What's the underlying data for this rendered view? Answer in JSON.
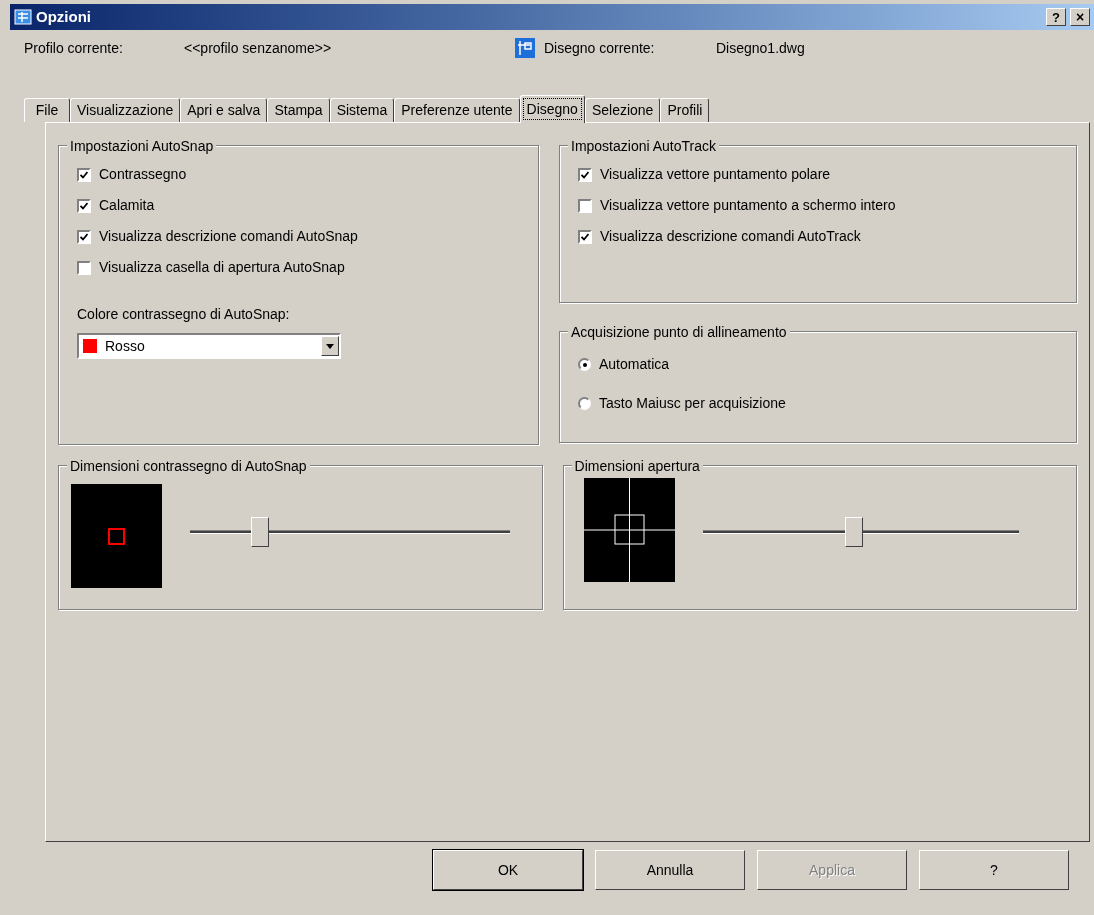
{
  "window": {
    "title": "Opzioni",
    "help_button": "?",
    "close_button": "×"
  },
  "profile": {
    "label": "Profilo corrente:",
    "value": "<<profilo senzanome>>"
  },
  "drawing": {
    "label": "Disegno corrente:",
    "value": "Disegno1.dwg"
  },
  "tabs": [
    {
      "label": "File",
      "selected": false
    },
    {
      "label": "Visualizzazione",
      "selected": false
    },
    {
      "label": "Apri e salva",
      "selected": false
    },
    {
      "label": "Stampa",
      "selected": false
    },
    {
      "label": "Sistema",
      "selected": false
    },
    {
      "label": "Preferenze utente",
      "selected": false
    },
    {
      "label": "Disegno",
      "selected": true
    },
    {
      "label": "Selezione",
      "selected": false
    },
    {
      "label": "Profili",
      "selected": false
    }
  ],
  "autosnap": {
    "title": "Impostazioni AutoSnap",
    "options": [
      {
        "label": "Contrassegno",
        "checked": true
      },
      {
        "label": "Calamita",
        "checked": true
      },
      {
        "label": "Visualizza descrizione comandi AutoSnap",
        "checked": true
      },
      {
        "label": "Visualizza casella di apertura AutoSnap",
        "checked": false
      }
    ],
    "color_label": "Colore contrassegno di AutoSnap:",
    "color_value": "Rosso",
    "color": "#ff0000"
  },
  "autotrack": {
    "title": "Impostazioni AutoTrack",
    "options": [
      {
        "label": "Visualizza vettore puntamento polare",
        "checked": true
      },
      {
        "label": "Visualizza vettore puntamento a schermo intero",
        "checked": false
      },
      {
        "label": "Visualizza descrizione comandi AutoTrack",
        "checked": true
      }
    ]
  },
  "alignment": {
    "title": "Acquisizione punto di allineamento",
    "options": [
      {
        "label": "Automatica",
        "selected": true
      },
      {
        "label": "Tasto Maiusc per acquisizione",
        "selected": false
      }
    ]
  },
  "marker_size": {
    "title": "Dimensioni contrassegno di AutoSnap",
    "level": 0.22
  },
  "aperture_size": {
    "title": "Dimensioni apertura",
    "level": 0.48
  },
  "buttons": [
    {
      "label": "OK",
      "default": true,
      "disabled": false
    },
    {
      "label": "Annulla",
      "default": false,
      "disabled": false
    },
    {
      "label": "Applica",
      "default": false,
      "disabled": true
    },
    {
      "label": "?",
      "default": false,
      "disabled": false
    }
  ]
}
